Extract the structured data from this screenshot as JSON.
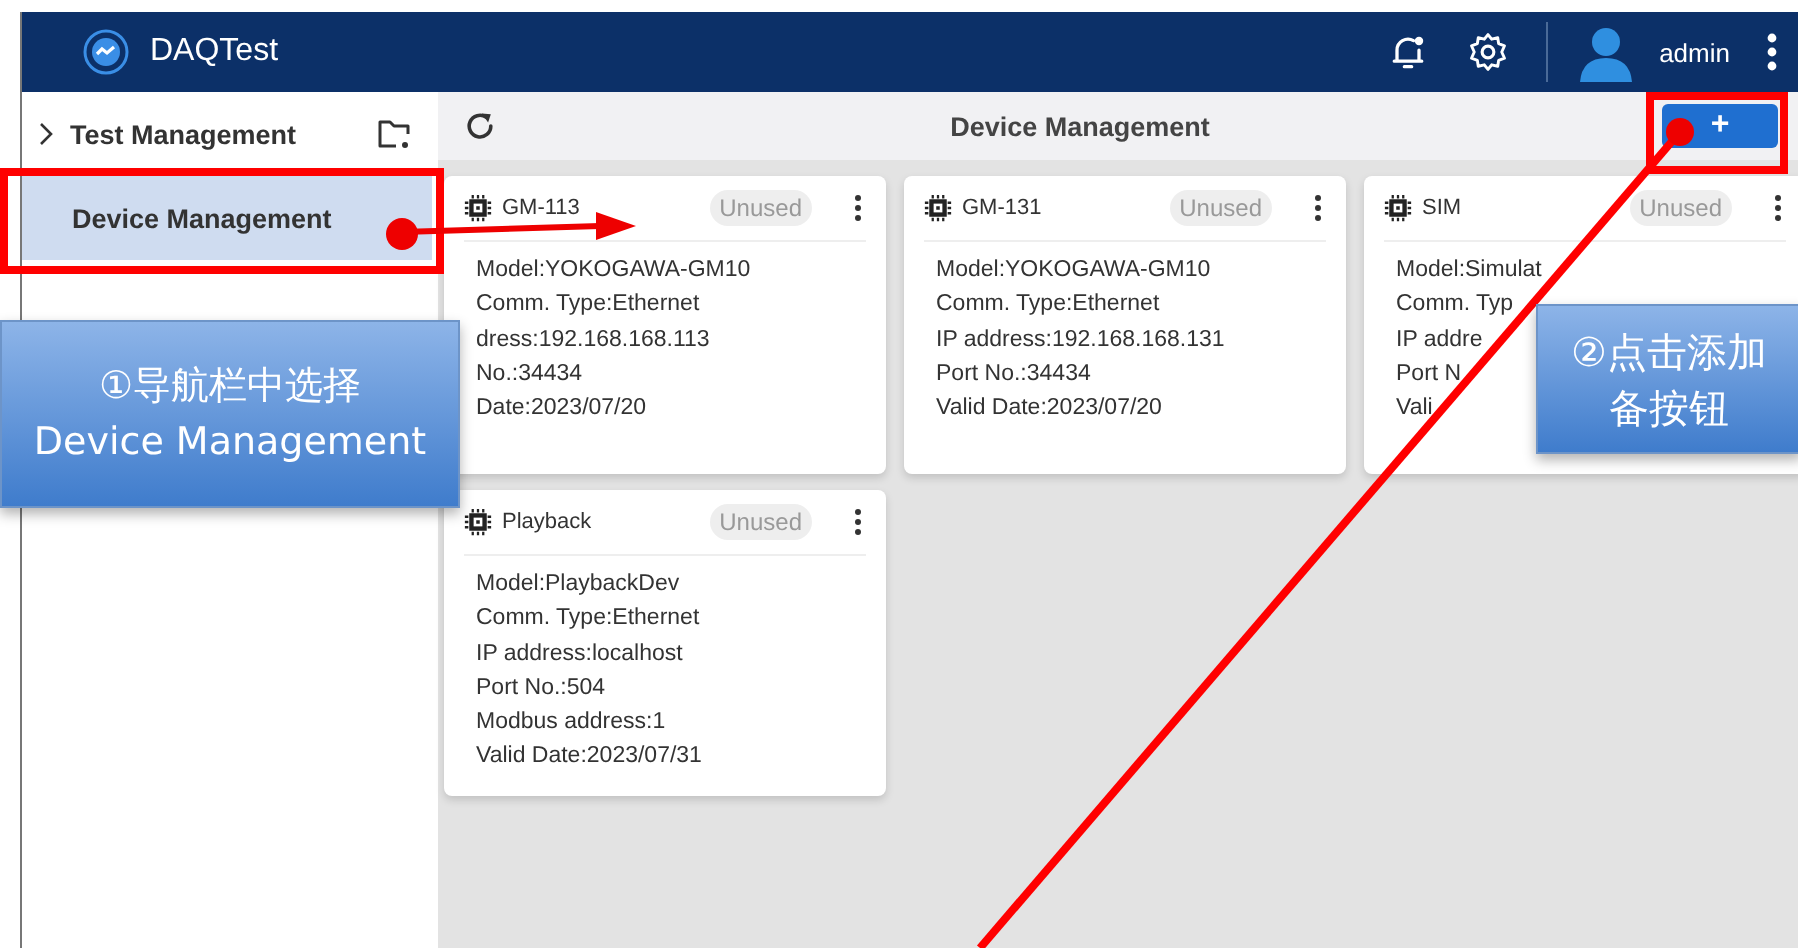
{
  "app": {
    "title": "DAQTest",
    "user": "admin"
  },
  "sidebar": {
    "items": [
      {
        "label": "Test Management",
        "kind": "group",
        "selected": false
      },
      {
        "label": "Device Management",
        "kind": "page",
        "selected": true
      }
    ]
  },
  "toolbar": {
    "title": "Device Management",
    "add_button": "+"
  },
  "devices": [
    {
      "name": "GM-113",
      "status": "Unused",
      "lines": [
        "Model:YOKOGAWA-GM10",
        "Comm. Type:Ethernet",
        "dress:192.168.168.113",
        "No.:34434",
        "Date:2023/07/20"
      ]
    },
    {
      "name": "GM-131",
      "status": "Unused",
      "lines": [
        "Model:YOKOGAWA-GM10",
        "Comm. Type:Ethernet",
        "IP address:192.168.168.131",
        "Port No.:34434",
        "Valid Date:2023/07/20"
      ]
    },
    {
      "name": "SIM",
      "status": "Unused",
      "lines": [
        "Model:Simulat",
        "Comm. Typ",
        "IP addre",
        "Port N",
        "Vali"
      ]
    },
    {
      "name": "Playback",
      "status": "Unused",
      "lines": [
        "Model:PlaybackDev",
        "Comm. Type:Ethernet",
        "IP address:localhost",
        "Port No.:504",
        "Modbus address:1",
        "Valid Date:2023/07/31"
      ]
    }
  ],
  "annotations": [
    {
      "text_lines": [
        "①导航栏中选择",
        "Device Management"
      ]
    },
    {
      "text_lines": [
        "②点击添加",
        "备按钮"
      ]
    }
  ]
}
